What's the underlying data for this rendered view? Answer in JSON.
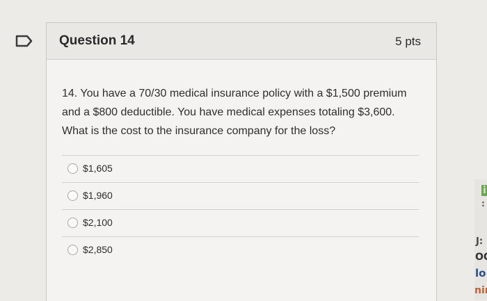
{
  "question": {
    "title": "Question 14",
    "points": "5 pts",
    "text": "14. You have a 70/30 medical insurance policy with a $1,500 premium and a $800 deductible. You have medical expenses totaling $3,600. What is the cost to the insurance company for the loss?",
    "answers": [
      "$1,605",
      "$1,960",
      "$2,100",
      "$2,850"
    ]
  },
  "edge_fragments": [
    "i",
    ":",
    "J:",
    "OC",
    "lo",
    "nir"
  ]
}
